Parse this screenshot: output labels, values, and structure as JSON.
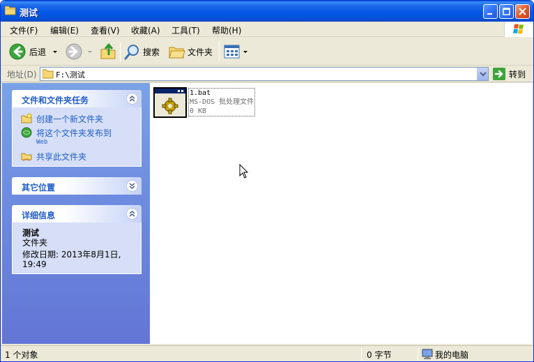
{
  "window": {
    "title": "测试"
  },
  "menu": [
    "文件(F)",
    "编辑(E)",
    "查看(V)",
    "收藏(A)",
    "工具(T)",
    "帮助(H)"
  ],
  "toolbar": {
    "back_label": "后退",
    "search_label": "搜索",
    "folders_label": "文件夹"
  },
  "address": {
    "label": "地址(D)",
    "value": "F:\\测试",
    "go_label": "转到"
  },
  "left_pane": {
    "tasks": {
      "title": "文件和文件夹任务",
      "items": [
        {
          "label": "创建一个新文件夹",
          "icon": "new-folder-icon"
        },
        {
          "label": "将这个文件夹发布到",
          "sub": "Web",
          "icon": "publish-web-icon"
        },
        {
          "label": "共享此文件夹",
          "icon": "share-folder-icon"
        }
      ]
    },
    "other_places": {
      "title": "其它位置"
    },
    "details": {
      "title": "详细信息",
      "name": "测试",
      "type": "文件夹",
      "modified_label": "修改日期: 2013年8月1日,",
      "modified_time": "19:49"
    }
  },
  "files": [
    {
      "name": "1.bat",
      "type": "MS-DOS 批处理文件",
      "size": "0 KB",
      "icon": "batch-file-icon"
    }
  ],
  "status": {
    "objects": "1 个对象",
    "bytes": "0 字节",
    "location": "我的电脑"
  },
  "colors": {
    "title_blue": "#0558E3",
    "task_text": "#215DC6",
    "pane_blue": "#6E8EE0",
    "window_bg": "#ECE9D8"
  }
}
